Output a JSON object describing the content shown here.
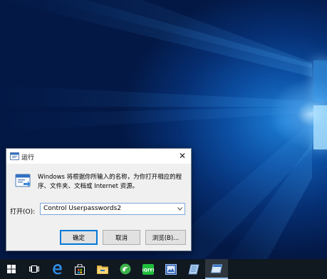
{
  "run_dialog": {
    "title": "运行",
    "description": "Windows 将根据你所输入的名称，为你打开相应的程序、文件夹、文档或 Internet 资源。",
    "open_label": "打开(O):",
    "open_value": "Control Userpasswords2",
    "ok_label": "确定",
    "cancel_label": "取消",
    "browse_label": "浏览(B)..."
  },
  "taskbar": {
    "items": [
      "start-icon",
      "task-view-icon",
      "edge-icon",
      "store-icon",
      "file-explorer-icon",
      "green-app-icon",
      "iqiyi-icon",
      "photo-app-icon",
      "notes-app-icon",
      "run-window-icon"
    ]
  },
  "colors": {
    "accent": "#0078d7",
    "desktop": "#0a4a9e",
    "taskbar": "#101820"
  }
}
